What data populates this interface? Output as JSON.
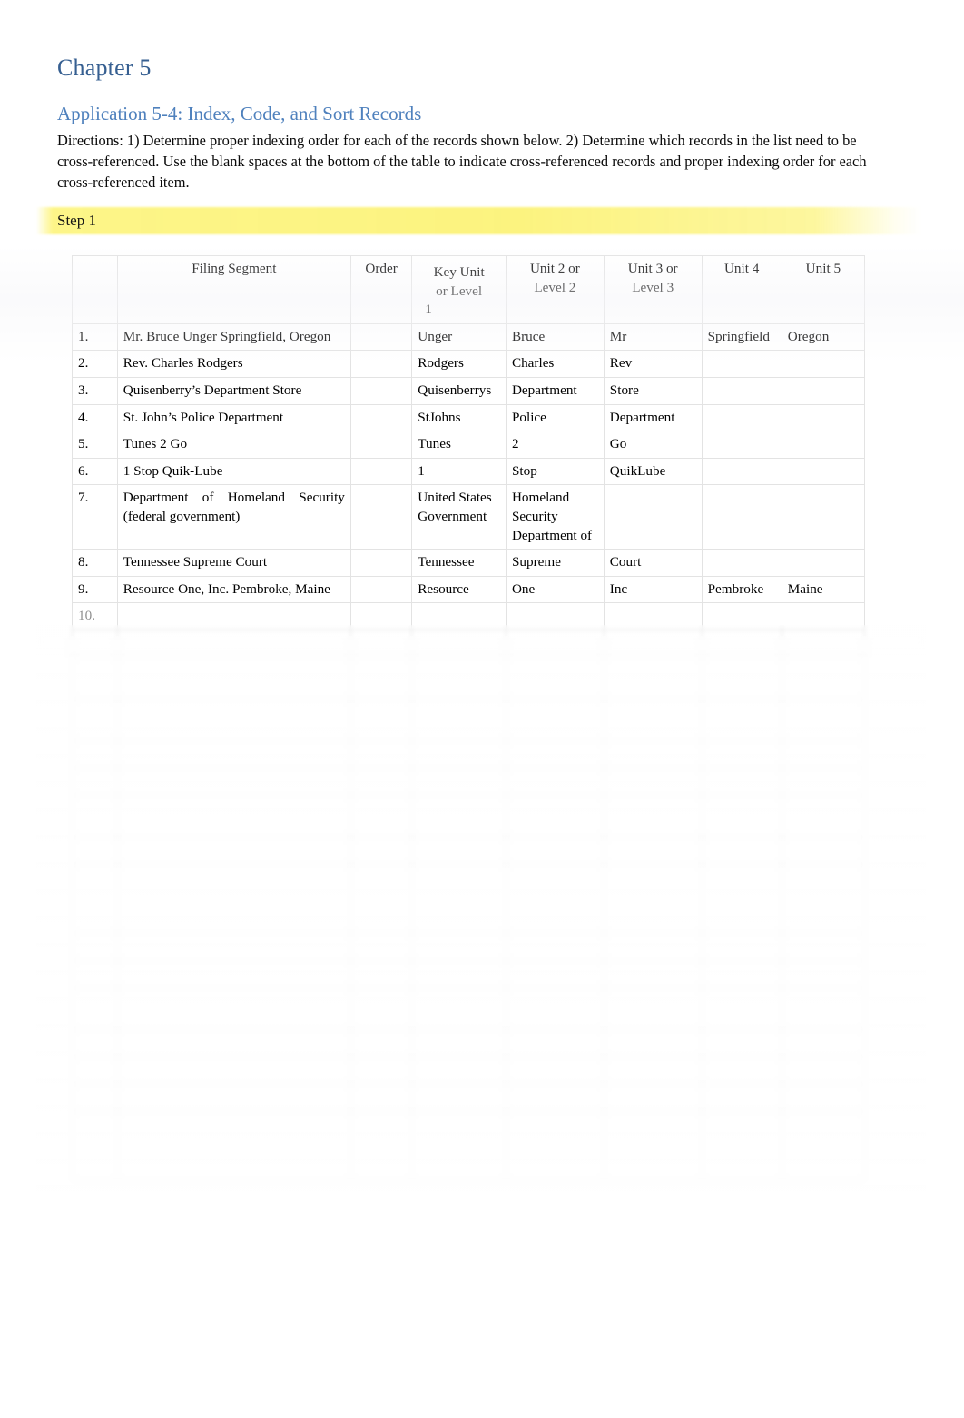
{
  "document": {
    "chapter_title": "Chapter 5",
    "application_title": "Application 5-4: Index, Code, and Sort Records",
    "directions": "Directions:  1) Determine proper indexing order for each of the records shown below. 2) Determine which records in the list need to be cross-referenced. Use the blank spaces at the bottom of the table to indicate cross-referenced records and proper indexing order for each cross-referenced item.",
    "step_label": "Step 1",
    "highlight_color": "#FCF37D",
    "chapter_color": "#365F91",
    "application_color": "#4F81BD"
  },
  "table": {
    "headers": {
      "number": "",
      "filing_segment": "Filing Segment",
      "order": "Order",
      "key_unit_line1": "Key Unit",
      "key_unit_line2": "or Level",
      "key_unit_line3": "1",
      "unit2_line1": "Unit 2 or",
      "unit2_line2": "Level 2",
      "unit3_line1": "Unit 3 or",
      "unit3_line2": "Level 3",
      "unit4": "Unit 4",
      "unit5": "Unit 5"
    },
    "rows": [
      {
        "number": "1.",
        "filing_segment": "Mr.  Bruce   Unger   Springfield, Oregon",
        "order": "",
        "key_unit": "Unger",
        "unit2": "Bruce",
        "unit3": "Mr",
        "unit4": "Springfield",
        "unit5": "Oregon"
      },
      {
        "number": "2.",
        "filing_segment": "Rev. Charles Rodgers",
        "order": "",
        "key_unit": "Rodgers",
        "unit2": "Charles",
        "unit3": "Rev",
        "unit4": "",
        "unit5": ""
      },
      {
        "number": "3.",
        "filing_segment": "Quisenberry’s      Department      Store",
        "order": "",
        "key_unit": "Quisenberrys",
        "unit2": "Department",
        "unit3": "Store",
        "unit4": "",
        "unit5": ""
      },
      {
        "number": "4.",
        "filing_segment": "St. John’s Police Department",
        "order": "",
        "key_unit": "StJohns",
        "unit2": "Police",
        "unit3": "Department",
        "unit4": "",
        "unit5": ""
      },
      {
        "number": "5.",
        "filing_segment": "Tunes 2 Go",
        "order": "",
        "key_unit": "Tunes",
        "unit2": "2",
        "unit3": "Go",
        "unit4": "",
        "unit5": ""
      },
      {
        "number": "6.",
        "filing_segment": "1  Stop   Quik-Lube",
        "order": "",
        "key_unit": "1",
        "unit2": "Stop",
        "unit3": "QuikLube",
        "unit4": "",
        "unit5": ""
      },
      {
        "number": "7.",
        "filing_segment": "Department of Homeland Security    (federal government)",
        "order": "",
        "key_unit": "United States Government",
        "unit2": "Homeland Security Department of",
        "unit3": "",
        "unit4": "",
        "unit5": ""
      },
      {
        "number": "8.",
        "filing_segment": "Tennessee      Supreme      Court",
        "order": "",
        "key_unit": "Tennessee",
        "unit2": "Supreme",
        "unit3": "Court",
        "unit4": "",
        "unit5": ""
      },
      {
        "number": "9.",
        "filing_segment": "Resource     One,   Inc. Pembroke, Maine",
        "order": "",
        "key_unit": "Resource",
        "unit2": "One",
        "unit3": "Inc",
        "unit4": "Pembroke",
        "unit5": "Maine"
      },
      {
        "number": "10.",
        "filing_segment": "",
        "order": "",
        "key_unit": "",
        "unit2": "",
        "unit3": "",
        "unit4": "",
        "unit5": "",
        "obscured": true
      }
    ],
    "obscured_note": "Rows below item 10 are blurred / illegible in the source image (locked preview)."
  },
  "footer": {
    "left": "",
    "page_number": ""
  }
}
